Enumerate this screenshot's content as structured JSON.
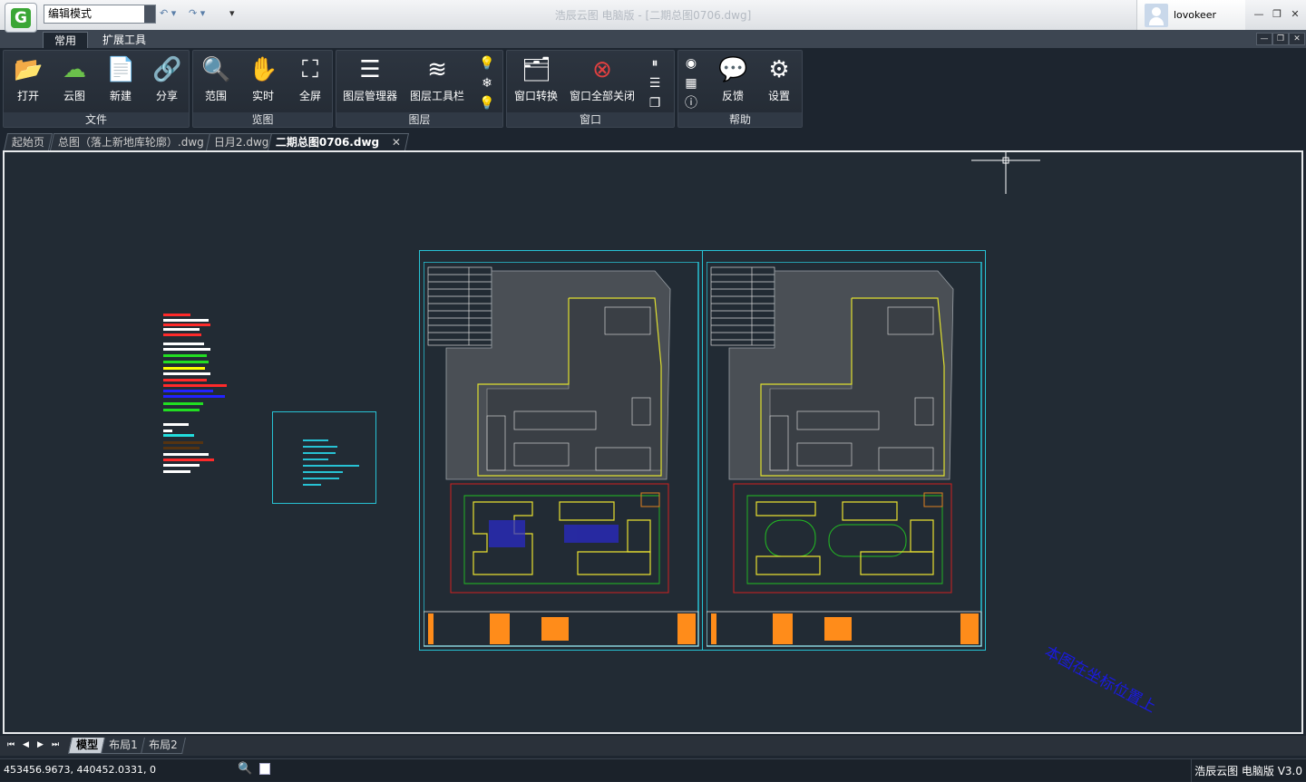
{
  "titlebar": {
    "mode": "编辑模式",
    "title": "浩辰云图 电脑版 - [二期总图0706.dwg]",
    "username": "lovokeer"
  },
  "ribbon": {
    "tabs": [
      "常用",
      "扩展工具"
    ],
    "groups": {
      "file": {
        "label": "文件",
        "buttons": [
          "打开",
          "云图",
          "新建",
          "分享"
        ]
      },
      "view": {
        "label": "览图",
        "buttons": [
          "范围",
          "实时",
          "全屏"
        ]
      },
      "layer": {
        "label": "图层",
        "buttons": [
          "图层管理器",
          "图层工具栏"
        ]
      },
      "window": {
        "label": "窗口",
        "buttons": [
          "窗口转换",
          "窗口全部关闭"
        ]
      },
      "help": {
        "label": "帮助",
        "buttons": [
          "反馈",
          "设置"
        ]
      }
    }
  },
  "doc_tabs": [
    "起始页",
    "总图（落上新地库轮廓）.dwg",
    "日月2.dwg",
    "二期总图0706.dwg"
  ],
  "canvas": {
    "annotation": "本图在坐标位置上"
  },
  "layout_tabs": [
    "模型",
    "布局1",
    "布局2"
  ],
  "status": {
    "coords": "453456.9673, 440452.0331, 0",
    "version": "浩辰云图 电脑版 V3.0"
  },
  "colors": {
    "background": "#222b34",
    "frame": "#27c2d4",
    "boundary": "#e0e030",
    "annotation": "#1a1ae0"
  }
}
